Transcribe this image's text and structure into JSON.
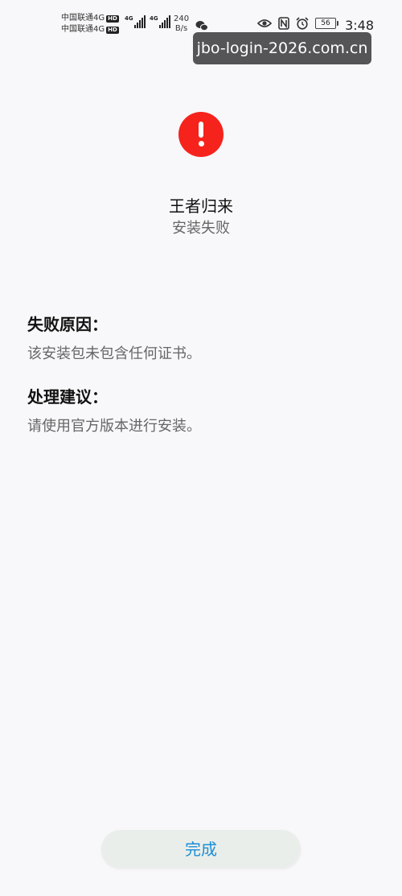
{
  "status_bar": {
    "carrier_1": "中国联通4G",
    "carrier_2": "中国联通4G",
    "hd_badge": "HD",
    "signal_1_label": "4G",
    "signal_2_label": "4G",
    "net_speed_value": "240",
    "net_speed_unit": "B/s",
    "battery_level": "56",
    "time": "3:48",
    "icons": [
      "wechat-icon",
      "eye-icon",
      "nfc-icon",
      "alarm-icon",
      "battery-icon"
    ]
  },
  "watermark": {
    "text": "jbo-login-2026.com.cn"
  },
  "header": {
    "icon": "alert-icon",
    "icon_color": "#f6231c",
    "app_name": "王者归来",
    "status": "安装失败"
  },
  "failure": {
    "heading": "失败原因：",
    "body": "该安装包未包含任何证书。"
  },
  "suggestion": {
    "heading": "处理建议：",
    "body": "请使用官方版本进行安装。"
  },
  "footer": {
    "done_label": "完成",
    "accent_color": "#1a8fd8"
  }
}
